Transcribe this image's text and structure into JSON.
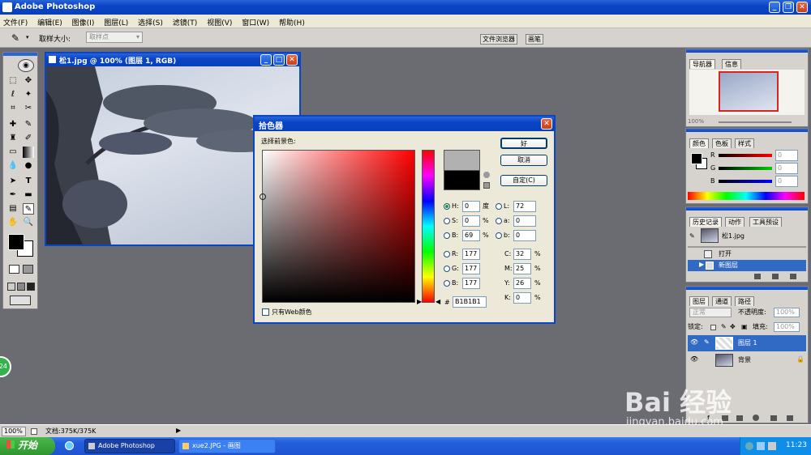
{
  "app": {
    "title": "Adobe Photoshop"
  },
  "menu": [
    "文件(F)",
    "编辑(E)",
    "图像(I)",
    "图层(L)",
    "选择(S)",
    "滤镜(T)",
    "视图(V)",
    "窗口(W)",
    "帮助(H)"
  ],
  "options_bar": {
    "sample_size_label": "取样大小:",
    "sample_size_value": "取样点",
    "tabs": [
      "文件浏览器",
      "画笔"
    ]
  },
  "document": {
    "title": "松1.jpg @ 100% (图层 1, RGB)"
  },
  "color_picker": {
    "title": "拾色器",
    "prompt": "选择前景色:",
    "buttons": {
      "ok": "好",
      "cancel": "取消",
      "custom": "自定(C)"
    },
    "hsb": {
      "h": "0",
      "s": "0",
      "b": "69",
      "h_unit": "度",
      "s_unit": "%",
      "b_unit": "%"
    },
    "rgb": {
      "r": "177",
      "g": "177",
      "b": "177"
    },
    "lab": {
      "l": "72",
      "a": "0",
      "b": "0"
    },
    "cmyk": {
      "c": "32",
      "m": "25",
      "y": "26",
      "k": "0"
    },
    "hex": "B1B1B1",
    "web_only_label": "只有Web颜色",
    "labels": {
      "h": "H:",
      "s": "S:",
      "b": "B:",
      "r": "R:",
      "g": "G:",
      "bb": "B:",
      "l": "L:",
      "a": "a:",
      "lb": "b:",
      "c": "C:",
      "m": "M:",
      "y": "Y:",
      "k": "K:",
      "hash": "#",
      "pct": "%"
    },
    "colors": {
      "new": "#b1b1b1",
      "current": "#000000",
      "hue": "#ff0000"
    }
  },
  "navigator_panel": {
    "tabs": [
      "导航器",
      "信息"
    ],
    "zoom": "100%"
  },
  "color_panel": {
    "tabs": [
      "颜色",
      "色板",
      "样式"
    ],
    "channels": [
      "R",
      "G",
      "B"
    ],
    "values": [
      "0",
      "0",
      "0"
    ]
  },
  "history_panel": {
    "tabs": [
      "历史记录",
      "动作",
      "工具预设"
    ],
    "snapshot": "松1.jpg",
    "steps": [
      "打开",
      "新图层"
    ]
  },
  "layers_panel": {
    "tabs": [
      "图层",
      "通道",
      "路径"
    ],
    "blend_mode": "正常",
    "opacity_label": "不透明度:",
    "opacity": "100%",
    "lock_label": "锁定:",
    "fill_label": "填充:",
    "fill": "100%",
    "layers": [
      "图层 1",
      "背景"
    ]
  },
  "status_bar": {
    "zoom": "100%",
    "doc": "文档:375K/375K"
  },
  "taskbar": {
    "start": "开始",
    "items": [
      "Adobe Photoshop",
      "xue2.JPG - 画图"
    ],
    "clock": "11:23"
  },
  "badge": "24",
  "watermark": {
    "brand": "Bai 经验",
    "url": "jingyan.baidu.com"
  }
}
